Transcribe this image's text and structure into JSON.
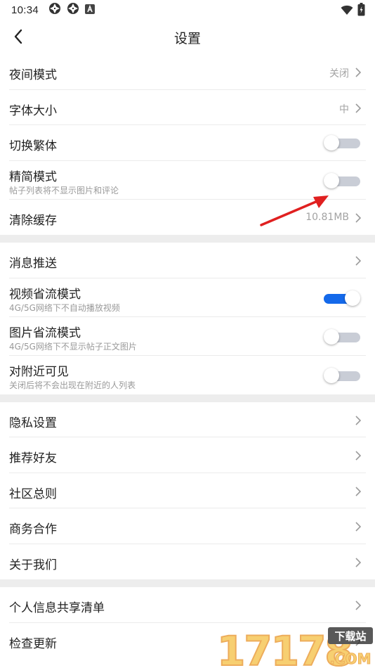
{
  "status_bar": {
    "time": "10:34",
    "left_icons": [
      "aperture-icon",
      "aperture-icon",
      "notification-a-icon"
    ],
    "right_icons": [
      "wifi-icon",
      "battery-charging-icon"
    ]
  },
  "navbar": {
    "title": "设置",
    "back_icon": "chevron-left-icon"
  },
  "sections": [
    {
      "items": [
        {
          "label": "夜间模式",
          "value": "关闭",
          "type": "nav"
        },
        {
          "label": "字体大小",
          "value": "中",
          "type": "nav"
        },
        {
          "label": "切换繁体",
          "type": "toggle",
          "on": false
        },
        {
          "label": "精简模式",
          "sub": "帖子列表将不显示图片和评论",
          "type": "toggle",
          "on": false
        },
        {
          "label": "清除缓存",
          "value": "10.81MB",
          "type": "nav"
        }
      ]
    },
    {
      "items": [
        {
          "label": "消息推送",
          "type": "nav"
        },
        {
          "label": "视频省流模式",
          "sub": "4G/5G网络下不自动播放视频",
          "type": "toggle",
          "on": true
        },
        {
          "label": "图片省流模式",
          "sub": "4G/5G网络下不显示帖子正文图片",
          "type": "toggle",
          "on": false
        },
        {
          "label": "对附近可见",
          "sub": "关闭后将不会出现在附近的人列表",
          "type": "toggle",
          "on": false
        }
      ]
    },
    {
      "items": [
        {
          "label": "隐私设置",
          "type": "nav"
        },
        {
          "label": "推荐好友",
          "type": "nav"
        },
        {
          "label": "社区总则",
          "type": "nav"
        },
        {
          "label": "商务合作",
          "type": "nav"
        },
        {
          "label": "关于我们",
          "type": "nav"
        }
      ]
    },
    {
      "items": [
        {
          "label": "个人信息共享清单",
          "type": "nav"
        },
        {
          "label": "检查更新",
          "type": "nav"
        }
      ]
    }
  ],
  "annotation": {
    "type": "red-arrow",
    "points_to": "精简模式"
  },
  "watermark": {
    "text": "17178",
    "badge": "下载站",
    "domain": ".COM"
  },
  "colors": {
    "accent": "#1469ea",
    "toggle_off_track": "#c9cdd6",
    "divider": "#ebebeb",
    "section_gap": "#ededed",
    "secondary_text": "#9a9a9a",
    "arrow": "#e02020"
  }
}
